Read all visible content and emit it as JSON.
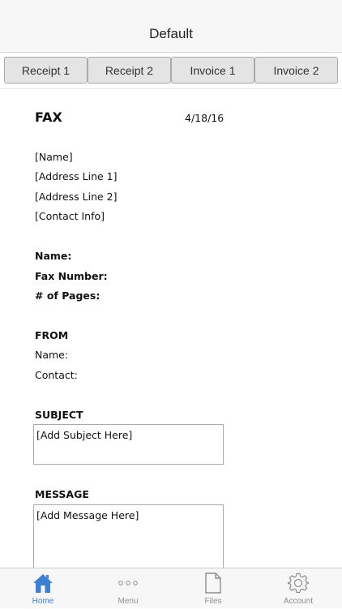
{
  "nav": {
    "title": "Default"
  },
  "templates": [
    "Receipt 1",
    "Receipt 2",
    "Invoice 1",
    "Invoice 2"
  ],
  "doc": {
    "title": "FAX",
    "date": "4/18/16",
    "sender": {
      "name": "[Name]",
      "address1": "[Address Line 1]",
      "address2": "[Address Line 2]",
      "contact": "[Contact Info]"
    },
    "to": {
      "name_label": "Name:",
      "fax_label": "Fax Number:",
      "pages_label": "# of Pages:"
    },
    "from": {
      "heading": "FROM",
      "name_label": "Name:",
      "contact_label": "Contact:"
    },
    "subject": {
      "heading": "SUBJECT",
      "placeholder": "[Add Subject Here]"
    },
    "message": {
      "heading": "MESSAGE",
      "placeholder": "[Add Message Here]"
    }
  },
  "tabbar": {
    "items": [
      {
        "label": "Home",
        "icon": "home-icon",
        "active": true
      },
      {
        "label": "Menu",
        "icon": "more-dots-icon",
        "active": false
      },
      {
        "label": "Files",
        "icon": "file-icon",
        "active": false
      },
      {
        "label": "Account",
        "icon": "gear-icon",
        "active": false
      }
    ],
    "active_color": "#3b82d6",
    "inactive_color": "#8e8e8e"
  }
}
